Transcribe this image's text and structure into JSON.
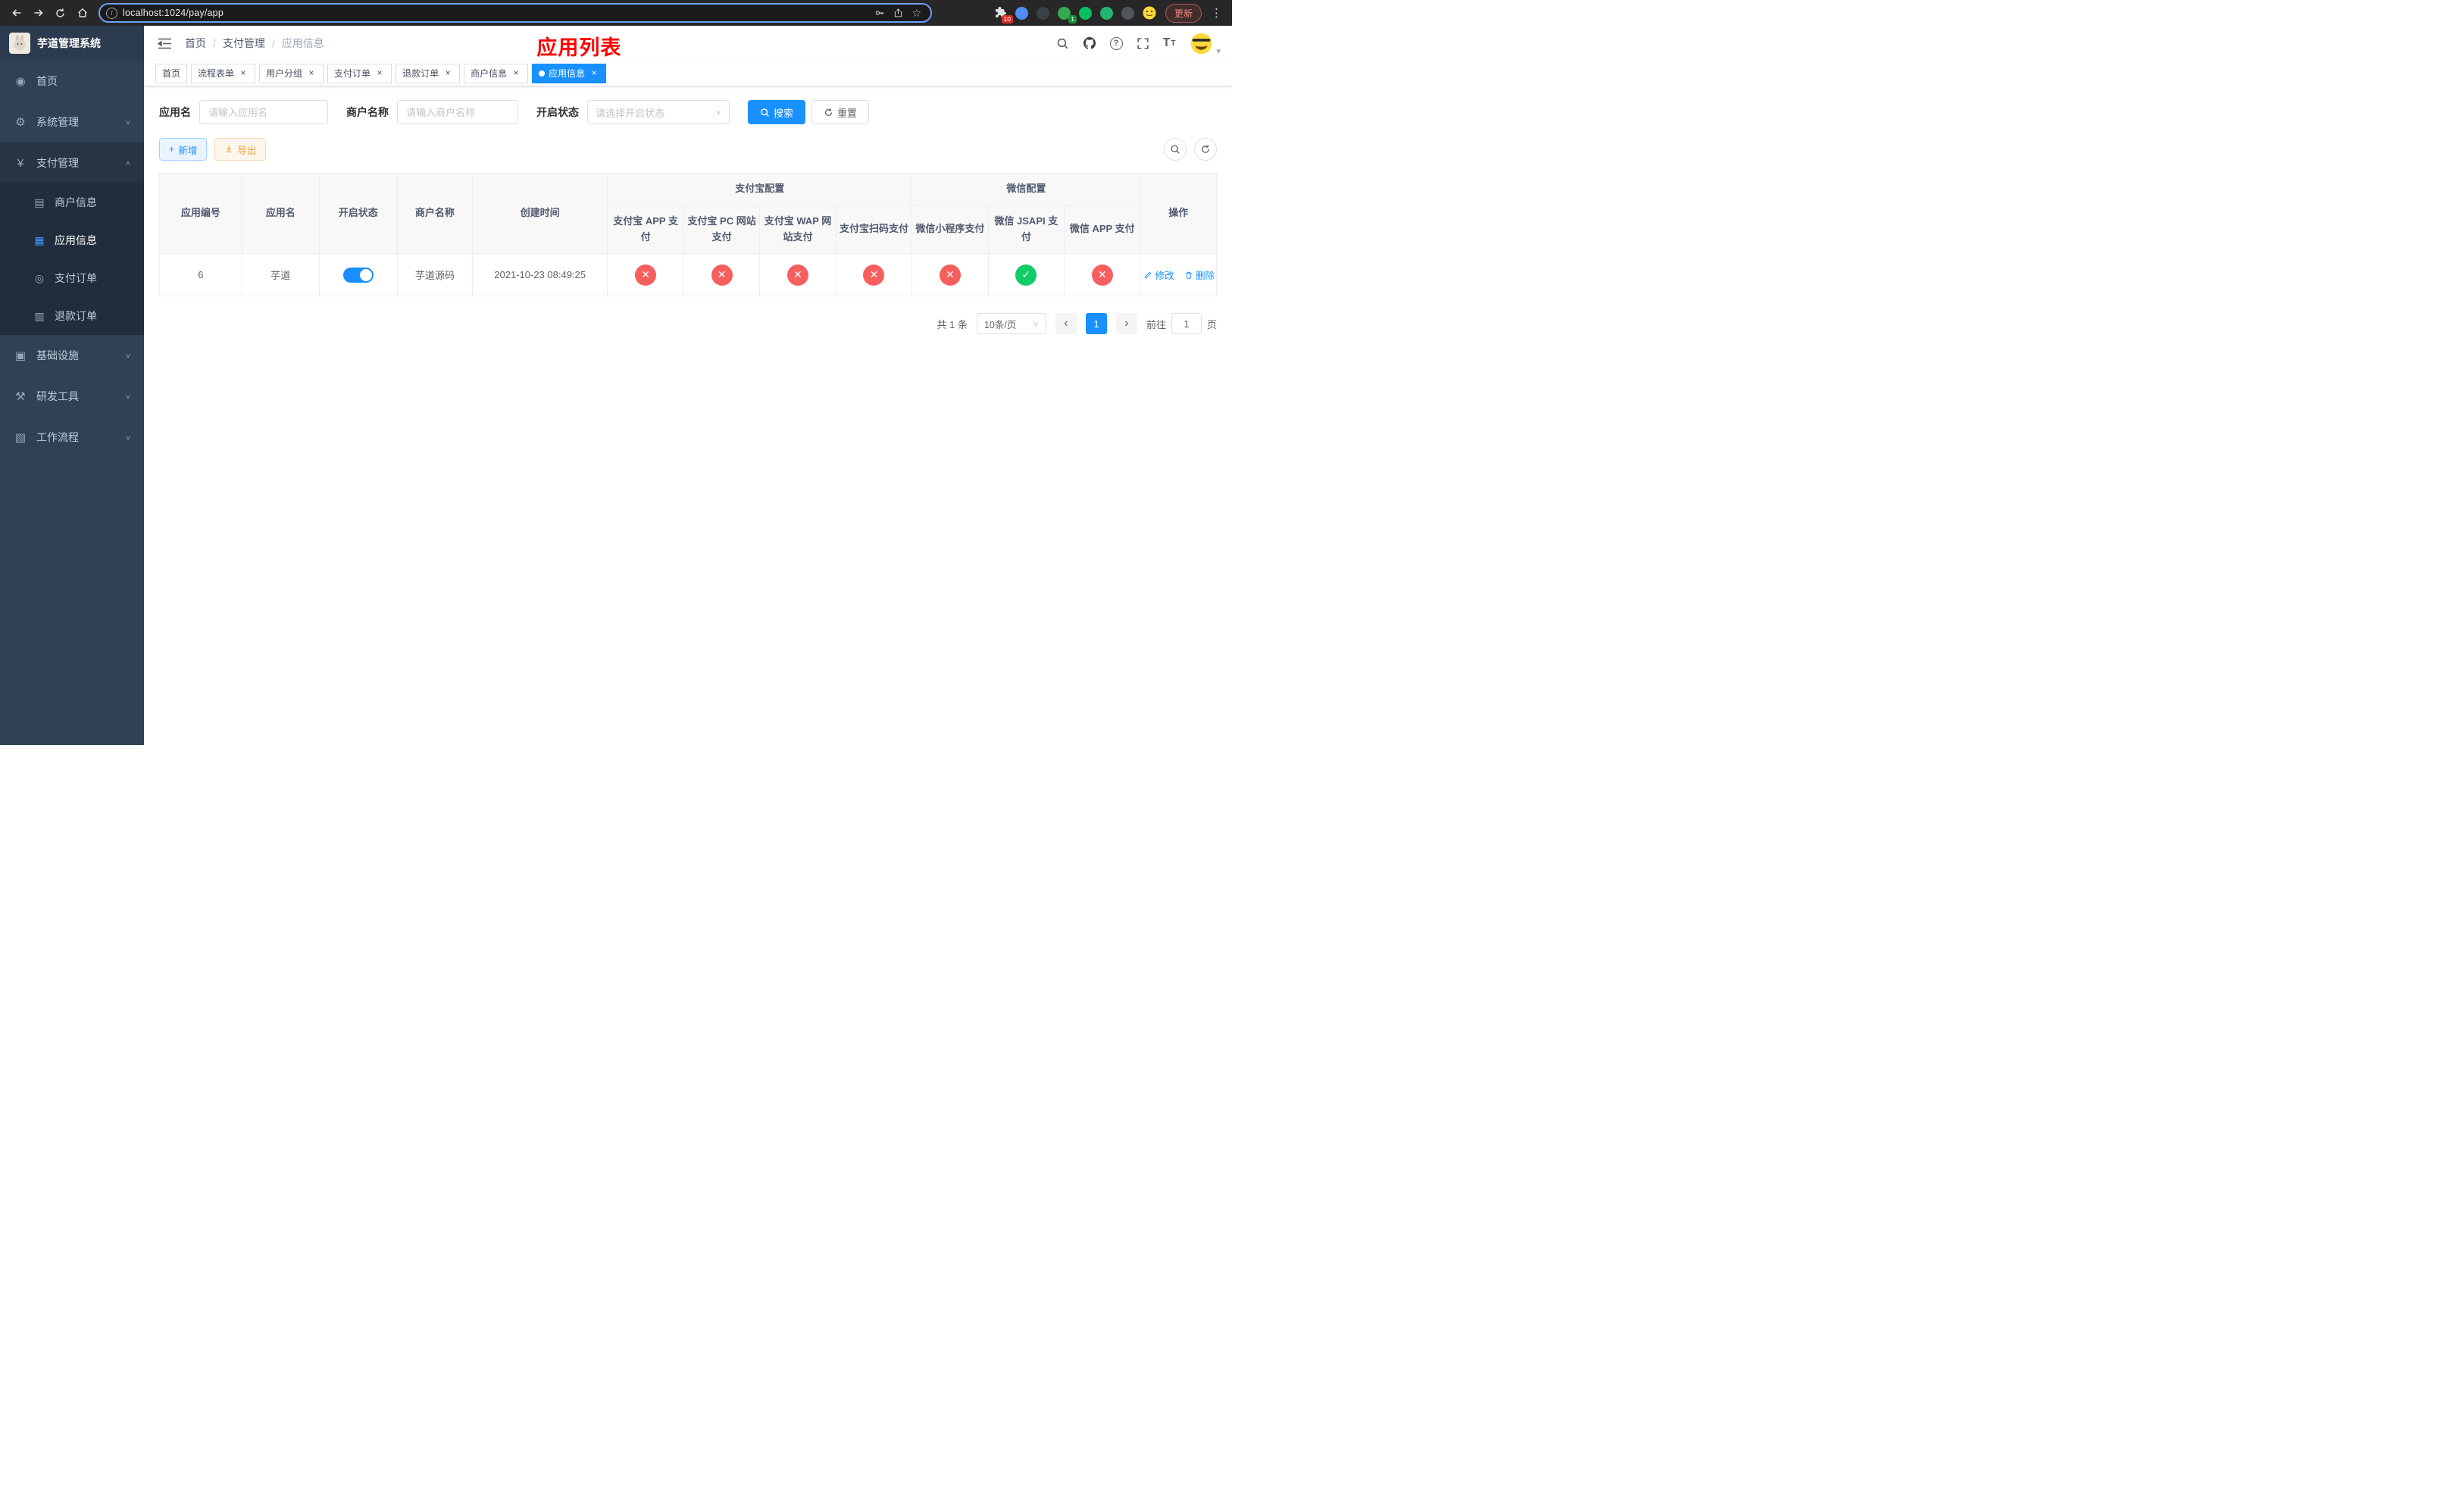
{
  "colors": {
    "primary": "#1890ff",
    "sidebar_bg": "#304156",
    "submenu_bg": "#1f2d3d",
    "danger_circle": "#f75e5e",
    "success_circle": "#0fce66",
    "warning": "#e6a23c",
    "page_title_red": "#ff0000"
  },
  "glyphs": {
    "star": "☆",
    "menu_dots": "⋮",
    "chevron_down": "∨",
    "chevron_up": "∧",
    "caret_down": "▾",
    "menu_home": "◉",
    "menu_system": "⚙",
    "menu_payment": "¥",
    "menu_merchant": "▤",
    "menu_app": "▦",
    "menu_order": "◎",
    "menu_refund": "▥",
    "menu_infra": "▣",
    "menu_tools": "⚒",
    "menu_workflow": "▧",
    "close": "×",
    "check": "✓",
    "cross": "✕",
    "plus": "+",
    "info": "i",
    "question": "?",
    "prev": "‹",
    "next": "›",
    "font_size": "T"
  },
  "browser": {
    "url": "localhost:1024/pay/app",
    "update_button": "更新",
    "extensions_badge": "10",
    "extension_badge_green": "1"
  },
  "sidebar": {
    "app_title": "芋道管理系统",
    "menu_home": "首页",
    "menu_system": "系统管理",
    "menu_payment": "支付管理",
    "menu_merchant_info": "商户信息",
    "menu_app_info": "应用信息",
    "menu_pay_order": "支付订单",
    "menu_refund_order": "退款订单",
    "menu_infra": "基础设施",
    "menu_dev_tools": "研发工具",
    "menu_workflow": "工作流程"
  },
  "topbar": {
    "breadcrumb": [
      "首页",
      "支付管理",
      "应用信息"
    ],
    "separator": "/",
    "page_title": "应用列表"
  },
  "tabs": [
    {
      "label": "首页",
      "closable": false,
      "active": false
    },
    {
      "label": "流程表单",
      "closable": true,
      "active": false
    },
    {
      "label": "用户分组",
      "closable": true,
      "active": false
    },
    {
      "label": "支付订单",
      "closable": true,
      "active": false
    },
    {
      "label": "退款订单",
      "closable": true,
      "active": false
    },
    {
      "label": "商户信息",
      "closable": true,
      "active": false
    },
    {
      "label": "应用信息",
      "closable": true,
      "active": true
    }
  ],
  "filters": {
    "app_name_label": "应用名",
    "app_name_placeholder": "请输入应用名",
    "merchant_name_label": "商户名称",
    "merchant_name_placeholder": "请输入商户名称",
    "status_label": "开启状态",
    "status_placeholder": "请选择开启状态",
    "search_button": "搜索",
    "reset_button": "重置"
  },
  "toolbar": {
    "add_button": "新增",
    "export_button": "导出"
  },
  "table": {
    "col_app_id": "应用编号",
    "col_app_name": "应用名",
    "col_status": "开启状态",
    "col_merchant_name": "商户名称",
    "col_created_at": "创建时间",
    "group_alipay": "支付宝配置",
    "group_wechat": "微信配置",
    "col_alipay_app": "支付宝 APP 支付",
    "col_alipay_pc": "支付宝 PC 网站支付",
    "col_alipay_wap": "支付宝 WAP 网站支付",
    "col_alipay_qr": "支付宝扫码支付",
    "col_wechat_mini": "微信小程序支付",
    "col_wechat_jsapi": "微信 JSAPI 支付",
    "col_wechat_app": "微信 APP 支付",
    "col_actions": "操作",
    "rows": [
      {
        "app_id": "6",
        "app_name": "芋道",
        "status_on": true,
        "merchant_name": "芋道源码",
        "created_at": "2021-10-23 08:49:25",
        "alipay_app": "disabled",
        "alipay_pc": "disabled",
        "alipay_wap": "disabled",
        "alipay_qr": "disabled",
        "wechat_mini": "disabled",
        "wechat_jsapi": "enabled",
        "wechat_app": "disabled",
        "edit_label": "修改",
        "delete_label": "删除"
      }
    ]
  },
  "pagination": {
    "total_text": "共 1 条",
    "page_size_text": "10条/页",
    "current_page": "1",
    "goto_label": "前往",
    "goto_value": "1",
    "goto_unit": "页"
  }
}
